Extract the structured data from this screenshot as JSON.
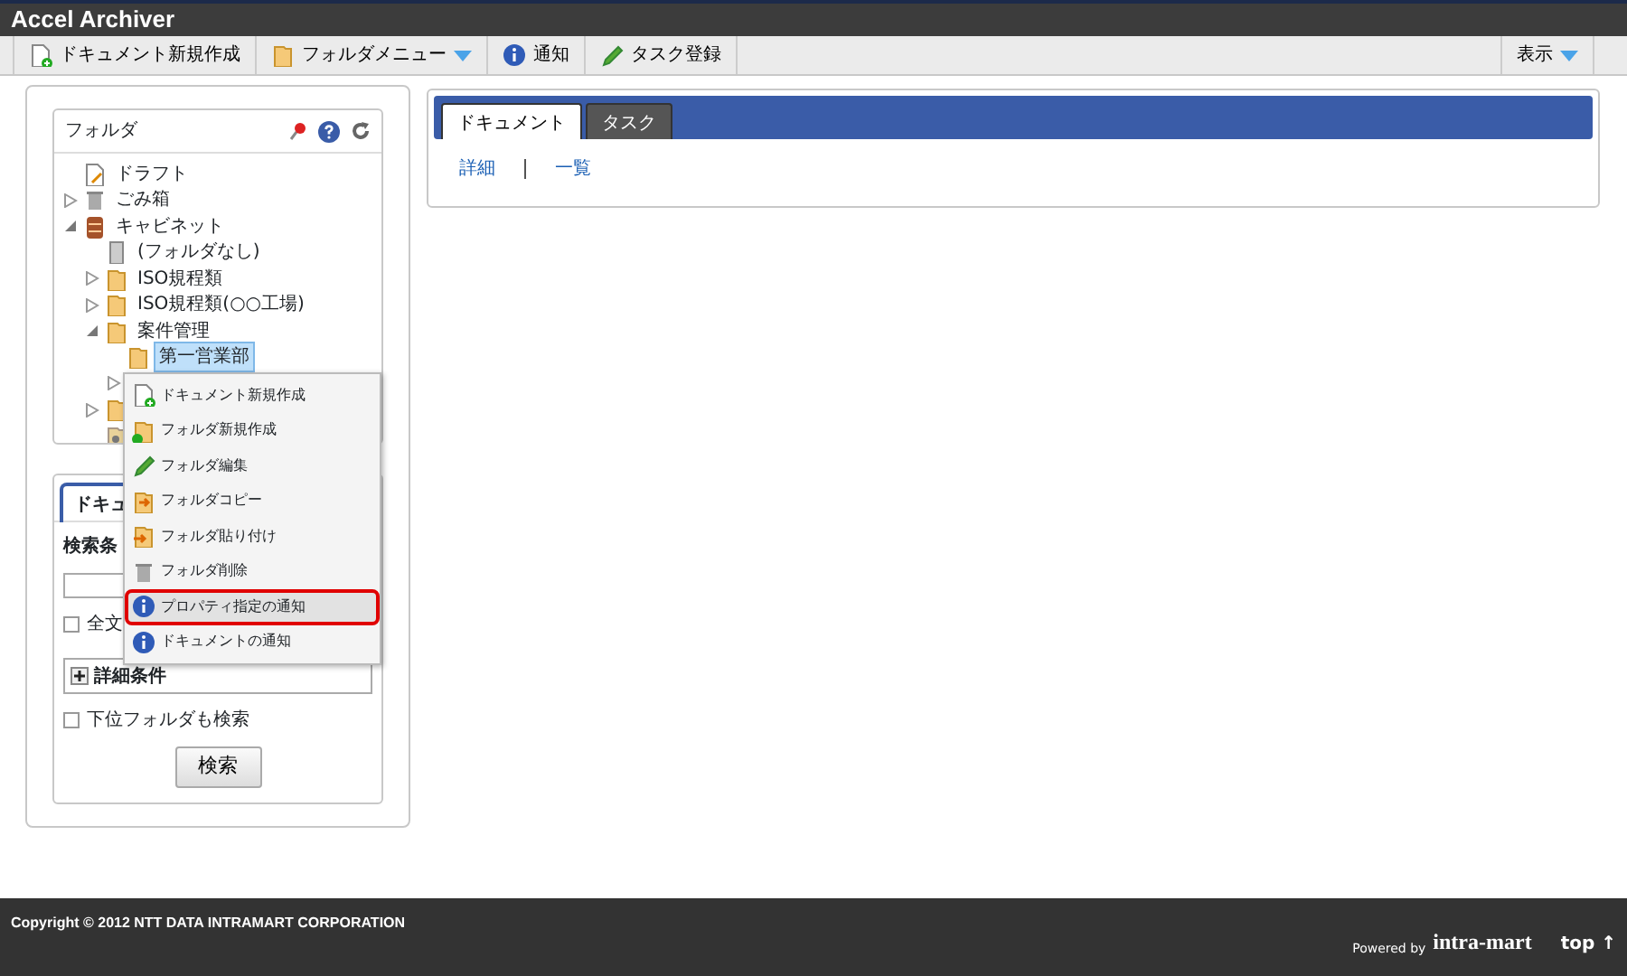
{
  "app_title": "Accel Archiver",
  "toolbar": [
    {
      "label": "ドキュメント新規作成",
      "kind": "newdoc"
    },
    {
      "label": "フォルダメニュー",
      "kind": "foldermenu"
    },
    {
      "label": "通知",
      "kind": "notify"
    },
    {
      "label": "タスク登録",
      "kind": "task"
    }
  ],
  "view_menu": {
    "label": "表示"
  },
  "folder_panel": {
    "title": "フォルダ",
    "tree": [
      {
        "label": "ドラフト",
        "kind": "draft"
      },
      {
        "label": "ごみ箱",
        "kind": "trash",
        "expanded": false
      },
      {
        "label": "キャビネット",
        "kind": "cabinet",
        "expanded": true,
        "children": [
          {
            "label": "(フォルダなし)",
            "kind": "file"
          },
          {
            "label": "ISO規程類",
            "kind": "folder",
            "expanded": false
          },
          {
            "label": "ISO規程類(○○工場)",
            "kind": "folder",
            "expanded": false
          },
          {
            "label": "案件管理",
            "kind": "folder",
            "expanded": true,
            "selected": false,
            "children": [
              {
                "label": "第一営業部",
                "kind": "folder",
                "selected": true
              },
              {
                "expanded": false
              }
            ]
          },
          {
            "kind": "folder",
            "expanded": false
          },
          {
            "kind": "special"
          }
        ]
      }
    ]
  },
  "search_panel": {
    "tab": "ドキュ",
    "condition_label": "検索条",
    "fulltext_label": "全文",
    "fulltext_checked": false,
    "detail_label": "詳細条件",
    "subfolder_label": "下位フォルダも検索",
    "subfolder_checked": false,
    "search_button": "検索"
  },
  "main_tabs": [
    {
      "label": "ドキュメント",
      "selected": true
    },
    {
      "label": "タスク",
      "selected": false
    }
  ],
  "main_links": [
    "詳細",
    "一覧"
  ],
  "context_menu": [
    {
      "label": "ドキュメント新規作成",
      "kind": "newdoc",
      "selected": false
    },
    {
      "label": "フォルダ新規作成",
      "kind": "newfolder",
      "selected": false
    },
    {
      "label": "フォルダ編集",
      "kind": "edit",
      "selected": false
    },
    {
      "label": "フォルダコピー",
      "kind": "copy",
      "selected": false
    },
    {
      "label": "フォルダ貼り付け",
      "kind": "paste",
      "selected": false
    },
    {
      "label": "フォルダ削除",
      "kind": "trash",
      "selected": false
    },
    {
      "label": "プロパティ指定の通知",
      "kind": "notify",
      "selected": true
    },
    {
      "label": "ドキュメントの通知",
      "kind": "notify",
      "selected": false
    }
  ],
  "footer": {
    "copyright": "Copyright © 2012 NTT DATA INTRAMART CORPORATION",
    "powered_by": "Powered by",
    "brand": "intra-mart",
    "top_link": "top ↑"
  }
}
